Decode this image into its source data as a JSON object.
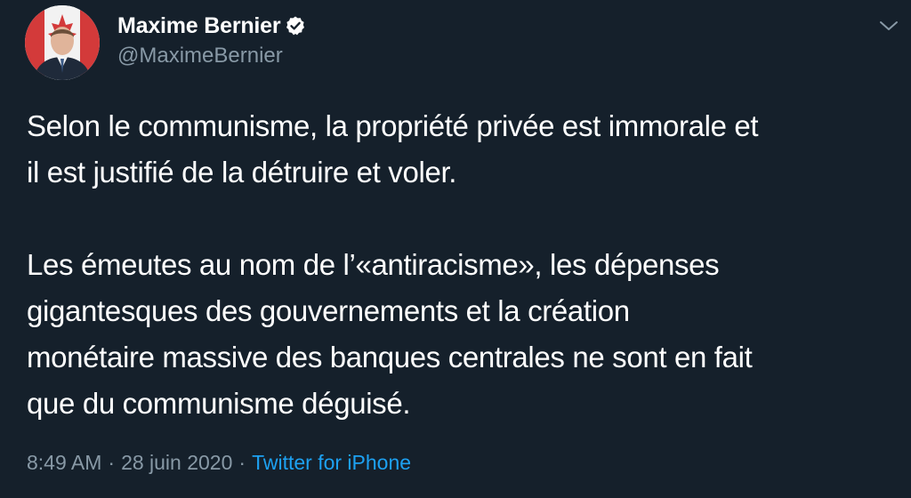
{
  "tweet": {
    "author": {
      "display_name": "Maxime Bernier",
      "handle": "@MaximeBernier",
      "verified": true,
      "avatar_icon": "profile-photo-icon",
      "verified_icon": "verified-badge-icon"
    },
    "body": {
      "paragraph_1": "Selon le communisme, la propriété privée est immorale et\nil est justifié de la détruire et voler.",
      "paragraph_2": "Les émeutes au nom de l’«antiracisme», les dépenses\ngigantesques des gouvernements et la création\nmonétaire massive des banques centrales ne sont en fait\nque du communisme déguisé."
    },
    "meta": {
      "time": "8:49 AM",
      "separator": "·",
      "date": "28 juin 2020",
      "source": "Twitter for iPhone"
    },
    "menu_icon": "chevron-down-icon"
  },
  "colors": {
    "background": "#15202B",
    "text_primary": "#FFFFFF",
    "text_secondary": "#8899A6",
    "accent": "#1DA1F2"
  }
}
